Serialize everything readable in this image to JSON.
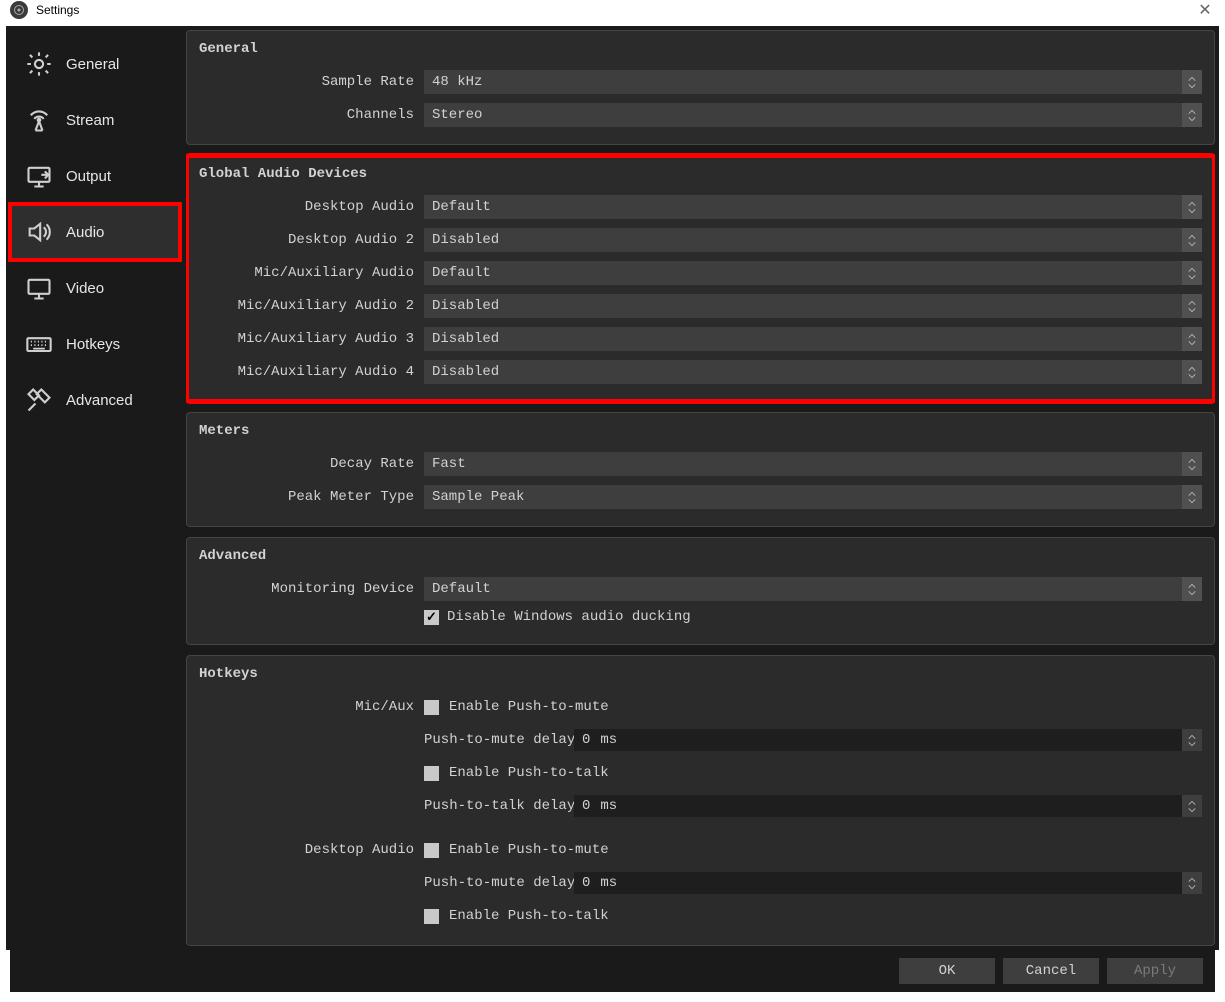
{
  "window": {
    "title": "Settings"
  },
  "sidebar": {
    "items": [
      {
        "key": "general",
        "label": "General"
      },
      {
        "key": "stream",
        "label": "Stream"
      },
      {
        "key": "output",
        "label": "Output"
      },
      {
        "key": "audio",
        "label": "Audio",
        "active": true
      },
      {
        "key": "video",
        "label": "Video"
      },
      {
        "key": "hotkeys",
        "label": "Hotkeys"
      },
      {
        "key": "advanced",
        "label": "Advanced"
      }
    ]
  },
  "general": {
    "title": "General",
    "sample_rate_label": "Sample Rate",
    "sample_rate_value": "48 kHz",
    "channels_label": "Channels",
    "channels_value": "Stereo"
  },
  "global_devices": {
    "title": "Global Audio Devices",
    "rows": [
      {
        "label": "Desktop Audio",
        "value": "Default"
      },
      {
        "label": "Desktop Audio 2",
        "value": "Disabled"
      },
      {
        "label": "Mic/Auxiliary Audio",
        "value": "Default"
      },
      {
        "label": "Mic/Auxiliary Audio 2",
        "value": "Disabled"
      },
      {
        "label": "Mic/Auxiliary Audio 3",
        "value": "Disabled"
      },
      {
        "label": "Mic/Auxiliary Audio 4",
        "value": "Disabled"
      }
    ]
  },
  "meters": {
    "title": "Meters",
    "decay_label": "Decay Rate",
    "decay_value": "Fast",
    "peak_label": "Peak Meter Type",
    "peak_value": "Sample Peak"
  },
  "advanced": {
    "title": "Advanced",
    "mon_label": "Monitoring Device",
    "mon_value": "Default",
    "ducking_checked": true,
    "ducking_label": "Disable Windows audio ducking"
  },
  "hotkeys": {
    "title": "Hotkeys",
    "micaux_label": "Mic/Aux",
    "desktop_label": "Desktop Audio",
    "pt_mute": "Enable Push-to-mute",
    "pt_mute_delay_label": "Push-to-mute delay",
    "pt_talk": "Enable Push-to-talk",
    "pt_talk_delay_label": "Push-to-talk delay",
    "delay_value": "0",
    "unit": "ms"
  },
  "footer": {
    "ok": "OK",
    "cancel": "Cancel",
    "apply": "Apply"
  }
}
